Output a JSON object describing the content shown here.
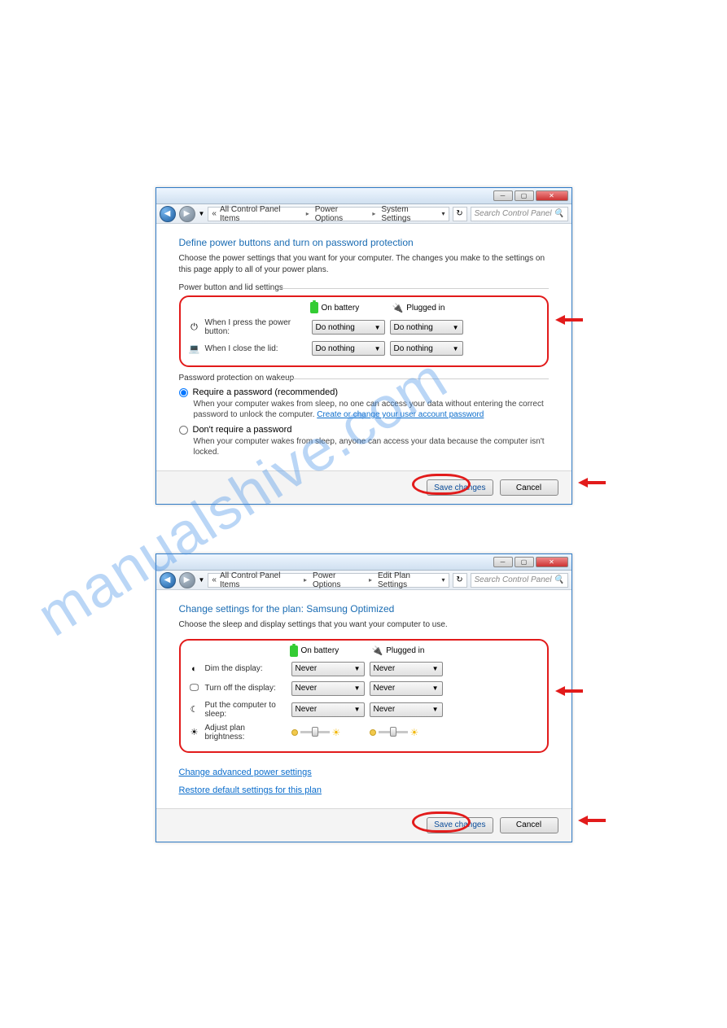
{
  "watermark": "manualshive.com",
  "window1": {
    "breadcrumb": [
      "All Control Panel Items",
      "Power Options",
      "System Settings"
    ],
    "search_placeholder": "Search Control Panel",
    "title": "Define power buttons and turn on password protection",
    "desc": "Choose the power settings that you want for your computer. The changes you make to the settings on this page apply to all of your power plans.",
    "group1_label": "Power button and lid settings",
    "col_battery": "On battery",
    "col_plugged": "Plugged in",
    "row_power": "When I press the power button:",
    "row_lid": "When I close the lid:",
    "dropdown_value": "Do nothing",
    "group2_label": "Password protection on wakeup",
    "radio1_label": "Require a password (recommended)",
    "radio1_desc": "When your computer wakes from sleep, no one can access your data without entering the correct password to unlock the computer. ",
    "radio1_link": "Create or change your user account password",
    "radio2_label": "Don't require a password",
    "radio2_desc": "When your computer wakes from sleep, anyone can access your data because the computer isn't locked.",
    "save": "Save changes",
    "cancel": "Cancel"
  },
  "window2": {
    "breadcrumb": [
      "All Control Panel Items",
      "Power Options",
      "Edit Plan Settings"
    ],
    "search_placeholder": "Search Control Panel",
    "title": "Change settings for the plan: Samsung Optimized",
    "desc": "Choose the sleep and display settings that you want your computer to use.",
    "col_battery": "On battery",
    "col_plugged": "Plugged in",
    "row_dim": "Dim the display:",
    "row_turnoff": "Turn off the display:",
    "row_sleep": "Put the computer to sleep:",
    "row_bright": "Adjust plan brightness:",
    "dropdown_value": "Never",
    "link_adv": "Change advanced power settings",
    "link_restore": "Restore default settings for this plan",
    "save": "Save changes",
    "cancel": "Cancel"
  }
}
